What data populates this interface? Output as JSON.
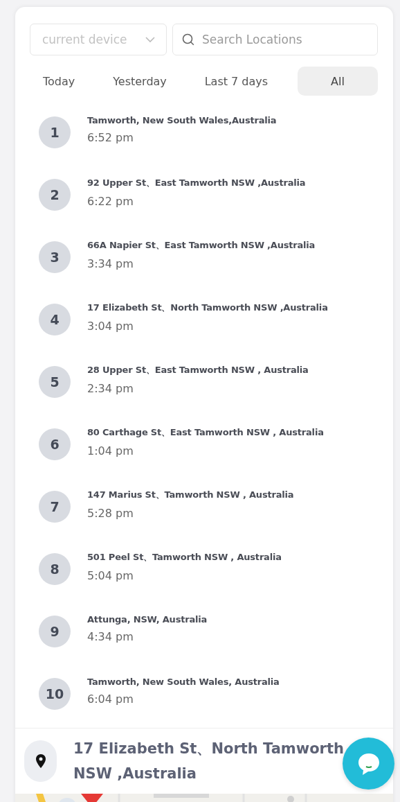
{
  "device_select": {
    "placeholder": "current device"
  },
  "search": {
    "placeholder": "Search Locations"
  },
  "tabs": [
    {
      "label": "Today",
      "selected": false
    },
    {
      "label": "Yesterday",
      "selected": false
    },
    {
      "label": "Last 7 days",
      "selected": false
    },
    {
      "label": "All",
      "selected": true
    }
  ],
  "locations": [
    {
      "index": "1",
      "address": "Tamworth, New South Wales,Australia",
      "time": "6:52 pm"
    },
    {
      "index": "2",
      "address": "92 Upper St、East Tamworth NSW ,Australia",
      "time": "6:22 pm"
    },
    {
      "index": "3",
      "address": "66A Napier St、East Tamworth NSW ,Australia",
      "time": "3:34 pm"
    },
    {
      "index": "4",
      "address": "17 Elizabeth St、North Tamworth NSW ,Australia",
      "time": "3:04 pm"
    },
    {
      "index": "5",
      "address": "28 Upper St、East Tamworth NSW , Australia",
      "time": "2:34 pm"
    },
    {
      "index": "6",
      "address": "80 Carthage St、East Tamworth NSW , Australia",
      "time": "1:04 pm"
    },
    {
      "index": "7",
      "address": "147 Marius St、Tamworth NSW , Australia",
      "time": "5:28 pm"
    },
    {
      "index": "8",
      "address": "501 Peel St、Tamworth NSW , Australia",
      "time": "5:04 pm"
    },
    {
      "index": "9",
      "address": "Attunga, NSW, Australia",
      "time": "4:34 pm"
    },
    {
      "index": "10",
      "address": "Tamworth, New South Wales, Australia",
      "time": "6:04 pm"
    }
  ],
  "selected_location": {
    "address": "17 Elizabeth St、North Tamworth NSW ,Australia"
  }
}
